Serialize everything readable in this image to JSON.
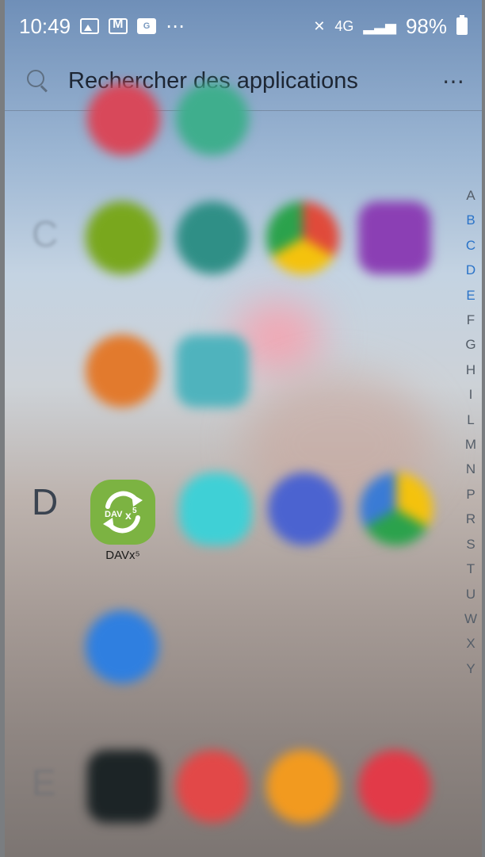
{
  "status_bar": {
    "time": "10:49",
    "overflow": "⋯",
    "network": "4G",
    "battery": "98%",
    "icons": [
      "photo-icon",
      "mail-icon",
      "gw-icon",
      "mute-icon",
      "signal-icon",
      "battery-icon"
    ]
  },
  "search": {
    "placeholder": "Rechercher des applications",
    "more": "⋯"
  },
  "sections": {
    "d_letter": "D"
  },
  "apps": {
    "davx5_label": "DAVx⁵"
  },
  "alphabet": [
    "A",
    "B",
    "C",
    "D",
    "E",
    "F",
    "G",
    "H",
    "I",
    "L",
    "M",
    "N",
    "P",
    "R",
    "S",
    "T",
    "U",
    "W",
    "X",
    "Y"
  ],
  "alphabet_active": [
    "B",
    "C",
    "D",
    "E"
  ],
  "colors": {
    "davx_green": "#7cb342",
    "index_active": "#2a73c8"
  }
}
